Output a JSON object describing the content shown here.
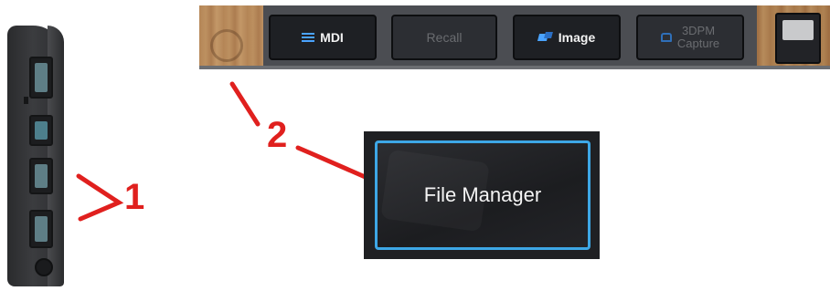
{
  "callouts": {
    "one": "1",
    "two": "2"
  },
  "toolbar": {
    "mdi_label": "MDI",
    "recall_label": "Recall",
    "image_label": "Image",
    "capture_line1": "3DPM",
    "capture_line2": "Capture"
  },
  "file_manager": {
    "label": "File Manager"
  },
  "colors": {
    "callout": "#e0201e",
    "accent": "#3da7e6",
    "button_bg": "#1e2024"
  },
  "icons": [
    "hamburger-icon",
    "image-icon",
    "camera-icon",
    "power-icon"
  ]
}
